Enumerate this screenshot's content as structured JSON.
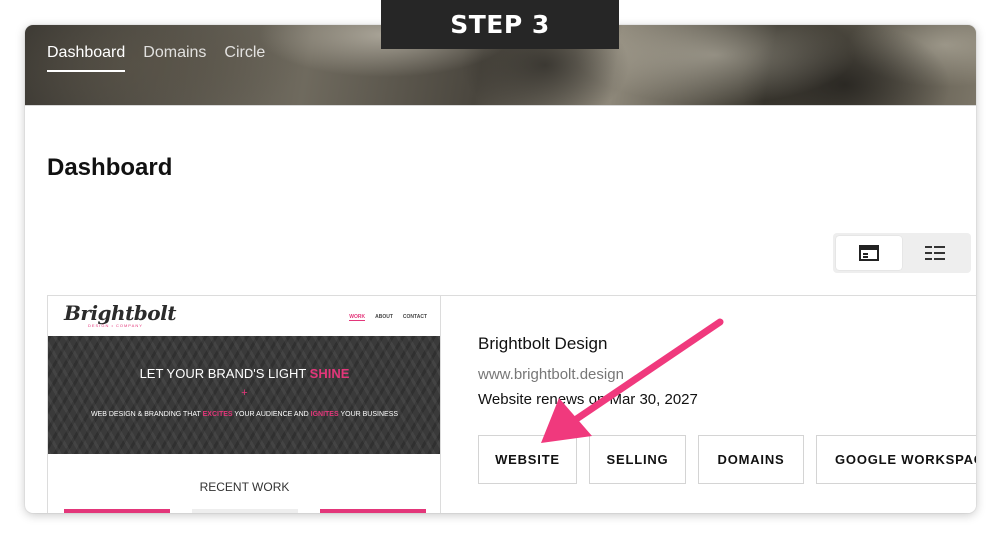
{
  "banner": {
    "step_label": "STEP 3"
  },
  "nav": {
    "tabs": [
      {
        "label": "Dashboard",
        "active": true
      },
      {
        "label": "Domains",
        "active": false
      },
      {
        "label": "Circle",
        "active": false
      }
    ]
  },
  "main": {
    "title": "Dashboard",
    "view_toggle": {
      "options": [
        "grid-view-icon",
        "list-view-icon"
      ],
      "selected": "grid-view-icon"
    }
  },
  "site": {
    "name": "Brightbolt Design",
    "url": "www.brightbolt.design",
    "renewal": "Website renews on Mar 30, 2027",
    "actions": [
      "WEBSITE",
      "SELLING",
      "DOMAINS",
      "GOOGLE WORKSPACE"
    ],
    "preview": {
      "logo": "Brightbolt",
      "logo_sub": "DESIGN • COMPANY",
      "nav": [
        "WORK",
        "ABOUT",
        "CONTACT"
      ],
      "hero_title_pre": "LET YOUR BRAND'S LIGHT ",
      "hero_title_accent": "SHINE",
      "hero_plus": "+",
      "hero_sub_1": "WEB DESIGN & BRANDING THAT ",
      "hero_sub_2": "EXCITES",
      "hero_sub_3": " YOUR AUDIENCE AND ",
      "hero_sub_4": "IGNITES",
      "hero_sub_5": " YOUR BUSINESS",
      "section_title": "RECENT WORK"
    }
  },
  "colors": {
    "accent_pink": "#e3367a",
    "banner_bg": "#262626",
    "annotation_arrow": "#f0397d"
  },
  "annotation": {
    "icon": "arrow-pointer-icon",
    "target": "WEBSITE"
  }
}
